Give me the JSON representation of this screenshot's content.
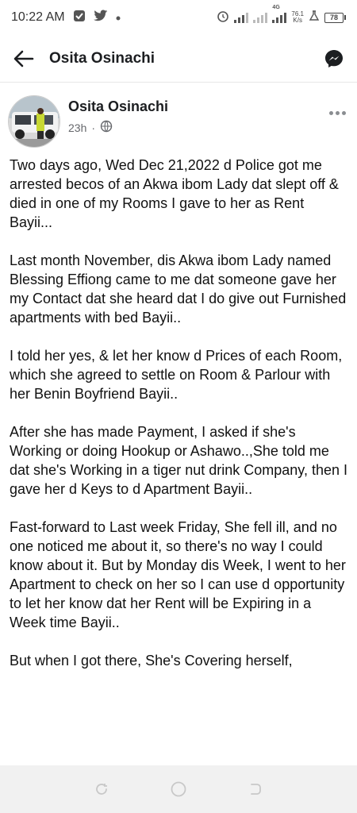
{
  "status_bar": {
    "time": "10:22 AM",
    "left_icons": [
      "gallery-icon",
      "twitter-icon",
      "dot-icon"
    ],
    "network_label": "4G",
    "speed_value": "76.1",
    "speed_unit": "K/s",
    "battery": "78"
  },
  "header": {
    "title": "Osita Osinachi",
    "back_icon": "arrow-left-icon",
    "action_icon": "messenger-icon"
  },
  "post": {
    "author": "Osita Osinachi",
    "time": "23h",
    "separator": "·",
    "privacy_icon": "globe-icon",
    "paragraphs": [
      "Two days ago, Wed Dec 21,2022 d Police got me arrested becos of an Akwa ibom Lady dat slept off & died in one of my Rooms I gave to her as Rent Bayii...",
      "Last month November, dis Akwa ibom Lady named Blessing Effiong came to me dat someone gave her my Contact dat she heard dat I do give out Furnished apartments with bed Bayii..",
      "I told her yes, & let her know d Prices of each Room, which she agreed to settle on Room & Parlour with her Benin Boyfriend Bayii..",
      "After she has made Payment, I asked if she's Working or doing Hookup or Ashawo..,She told me dat she's Working in a tiger nut drink Company, then I gave her d Keys to d Apartment Bayii..",
      "Fast-forward to Last week Friday, She fell ill, and no one noticed me about it, so there's no way I could know about it. But by Monday dis Week, I went to her Apartment to check on her so I can use d opportunity to let her know dat her Rent will be Expiring in a Week time Bayii..",
      "But when I got there, She's Covering herself,"
    ]
  },
  "nav": {
    "items": [
      "recent-apps-icon",
      "home-icon",
      "back-nav-icon"
    ]
  }
}
